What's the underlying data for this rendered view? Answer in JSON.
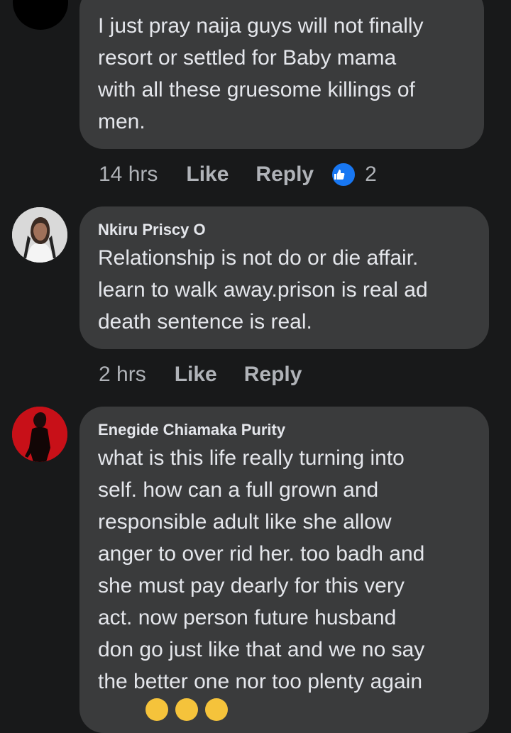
{
  "comments": [
    {
      "text": "I just pray naija guys will not finally\nresort or settled for Baby mama\nwith all these gruesome killings of\nmen.",
      "time": "14 hrs",
      "like_label": "Like",
      "reply_label": "Reply",
      "reaction_count": "2"
    },
    {
      "author": "Nkiru Priscy O",
      "text": "Relationship is not do or die affair.\nlearn to walk away.prison is real ad\ndeath sentence is real.",
      "time": "2 hrs",
      "like_label": "Like",
      "reply_label": "Reply"
    },
    {
      "author": "Enegide Chiamaka Purity",
      "text": "what is this life really turning into\nself. how can a full grown and\nresponsible adult like she allow\nanger to over rid her. too badh and\nshe must pay dearly for this very\nact. now person future husband\ndon go just like that  and we no say\nthe better one nor too plenty again"
    }
  ],
  "colors": {
    "background": "#18191a",
    "bubble": "#3a3b3c",
    "text": "#e4e6eb",
    "meta": "#b0b3b8",
    "like_badge": "#1877f2"
  }
}
